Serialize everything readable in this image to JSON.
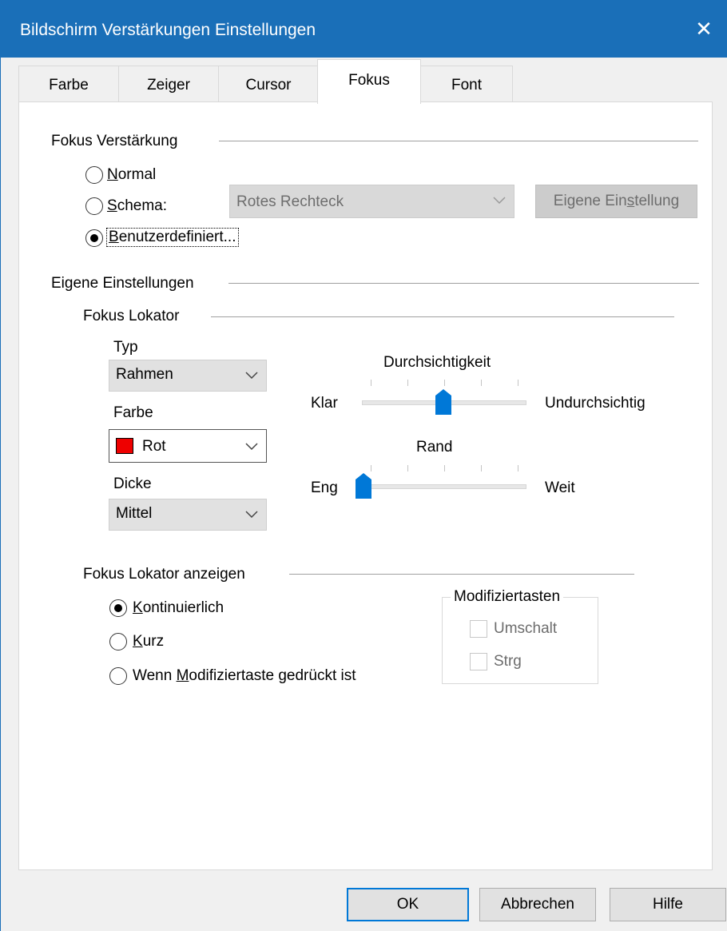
{
  "window": {
    "title": "Bildschirm Verstärkungen Einstellungen",
    "close_glyph": "✕"
  },
  "tabs": [
    {
      "label": "Farbe"
    },
    {
      "label": "Zeiger"
    },
    {
      "label": "Cursor"
    },
    {
      "label": "Fokus",
      "active": true
    },
    {
      "label": "Font"
    }
  ],
  "fokus_verstaerkung": {
    "heading": "Fokus Verstärkung",
    "normal": {
      "mnemonic": "N",
      "rest": "ormal"
    },
    "schema": {
      "mnemonic": "S",
      "rest": "chema:"
    },
    "benutzer": {
      "mnemonic": "B",
      "rest": "enutzerdefiniert..."
    },
    "selected": "benutzerdefiniert",
    "schema_combo_value": "Rotes Rechteck",
    "eigene_button": {
      "before": "Eigene Ein",
      "mnemonic": "s",
      "after": "tellung"
    }
  },
  "eigene_einstellungen": {
    "heading": "Eigene Einstellungen",
    "fokus_lokator": {
      "heading": "Fokus Lokator",
      "typ_label": "Typ",
      "typ_value": "Rahmen",
      "farbe_label": "Farbe",
      "farbe_value": "Rot",
      "farbe_swatch": "#ee0000",
      "dicke_label": "Dicke",
      "dicke_value": "Mittel",
      "durchsicht": {
        "label": "Durchsichtigkeit",
        "left": "Klar",
        "right": "Undurchsichtig",
        "position": 0.5
      },
      "rand": {
        "label": "Rand",
        "left": "Eng",
        "right": "Weit",
        "position": 0.0
      }
    }
  },
  "anzeigen": {
    "heading": "Fokus Lokator anzeigen",
    "kontinuierlich": {
      "mnemonic": "K",
      "rest": "ontinuierlich"
    },
    "kurz": {
      "mnemonic": "K",
      "rest": "urz"
    },
    "wenn": {
      "before": "Wenn ",
      "mnemonic": "M",
      "after": "odifiziertaste gedrückt ist"
    },
    "selected": "kontinuierlich",
    "modifier_group": {
      "title": "Modifiziertasten",
      "umschalt": "Umschalt",
      "strg": "Strg"
    }
  },
  "footer": {
    "ok": "OK",
    "cancel": "Abbrechen",
    "help": "Hilfe"
  },
  "accent_color": "#0078d7"
}
